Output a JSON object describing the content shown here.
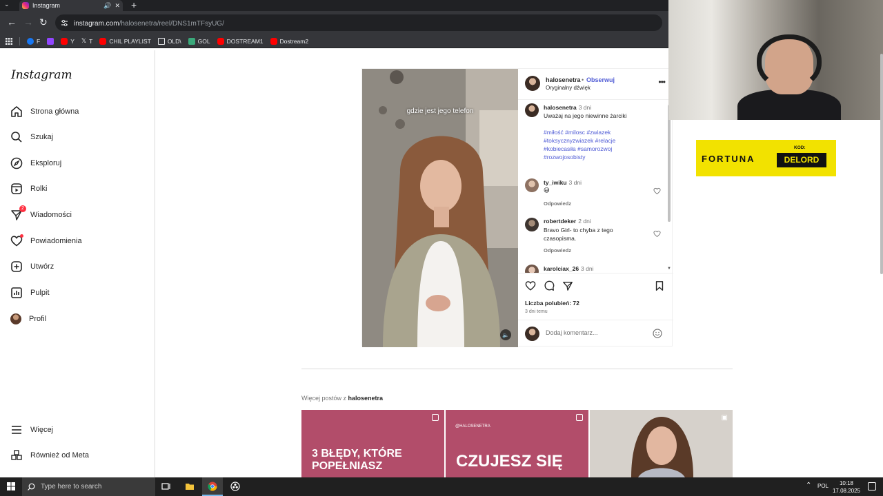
{
  "browser": {
    "tab_title": "Instagram",
    "url_host": "instagram.com",
    "url_path": "/halosenetra/reel/DNS1mTFsyUG/",
    "bookmarks": [
      {
        "label": "F",
        "color": "#1877f2"
      },
      {
        "label": "",
        "color": "#9146ff"
      },
      {
        "label": "Y",
        "color": "#ff0000"
      },
      {
        "label": "T",
        "color": "#000000"
      },
      {
        "label": "CHIL PLAYLIST",
        "color": "#ff0000"
      },
      {
        "label": "OLD\\",
        "color": "#e8eaed"
      },
      {
        "label": "GOL",
        "color": "#3aa87a"
      },
      {
        "label": "DOSTREAM1",
        "color": "#ff0000"
      },
      {
        "label": "Dostream2",
        "color": "#ff0000"
      }
    ]
  },
  "sidebar": {
    "logo": "Instagram",
    "items": [
      {
        "label": "Strona główna",
        "icon": "home-icon"
      },
      {
        "label": "Szukaj",
        "icon": "search-icon"
      },
      {
        "label": "Eksploruj",
        "icon": "compass-icon"
      },
      {
        "label": "Rolki",
        "icon": "reels-icon"
      },
      {
        "label": "Wiadomości",
        "icon": "messenger-icon",
        "badge": "2"
      },
      {
        "label": "Powiadomienia",
        "icon": "heart-icon"
      },
      {
        "label": "Utwórz",
        "icon": "plus-icon"
      },
      {
        "label": "Pulpit",
        "icon": "dashboard-icon"
      },
      {
        "label": "Profil",
        "icon": "avatar"
      }
    ],
    "bottom": [
      {
        "label": "Więcej",
        "icon": "menu-icon"
      },
      {
        "label": "Również od Meta",
        "icon": "meta-icon"
      }
    ]
  },
  "post": {
    "video_caption": "gdzie jest jego telefon",
    "author": "halosenetra",
    "separator": "•",
    "follow": "Obserwuj",
    "audio": "Oryginalny dźwięk",
    "caption": {
      "user": "halosenetra",
      "time": "3 dni",
      "text": "Uważaj na jego niewinne żarciki",
      "tags": "#miłość #milosc #zwiazek #toksycznyzwiazek #relacje #kobiecasiła #samorozwoj #rozwojosobisty"
    },
    "comments": [
      {
        "user": "ty_iwiku",
        "time": "3 dni",
        "text": "😅",
        "reply": "Odpowiedz"
      },
      {
        "user": "robertdeker",
        "time": "2 dni",
        "text": "Bravo Girl- to chyba z tego czasopisma.",
        "reply": "Odpowiedz"
      },
      {
        "user": "karolciax_26",
        "time": "3 dni",
        "text": "",
        "reply": ""
      }
    ],
    "likes": "Liczba polubień: 72",
    "posted": "3 dni temu",
    "comment_placeholder": "Dodaj komentarz..."
  },
  "more_posts": {
    "prefix": "Więcej postów z",
    "user": "halosenetra",
    "tiles": [
      {
        "text": "3 BŁĘDY, KTÓRE POPEŁNIASZ",
        "handle": ""
      },
      {
        "text": "CZUJESZ SIĘ",
        "handle": "@HALOSENETRA"
      },
      {
        "text": "",
        "handle": ""
      }
    ]
  },
  "overlay": {
    "sponsor_name": "FORTUNA",
    "sponsor_code_label": "KOD:",
    "sponsor_code": "DELORD",
    "sponsor_color": "#f2e200"
  },
  "taskbar": {
    "search_placeholder": "Type here to search",
    "lang": "POL",
    "time": "10:18",
    "date": "17.08.2025"
  }
}
